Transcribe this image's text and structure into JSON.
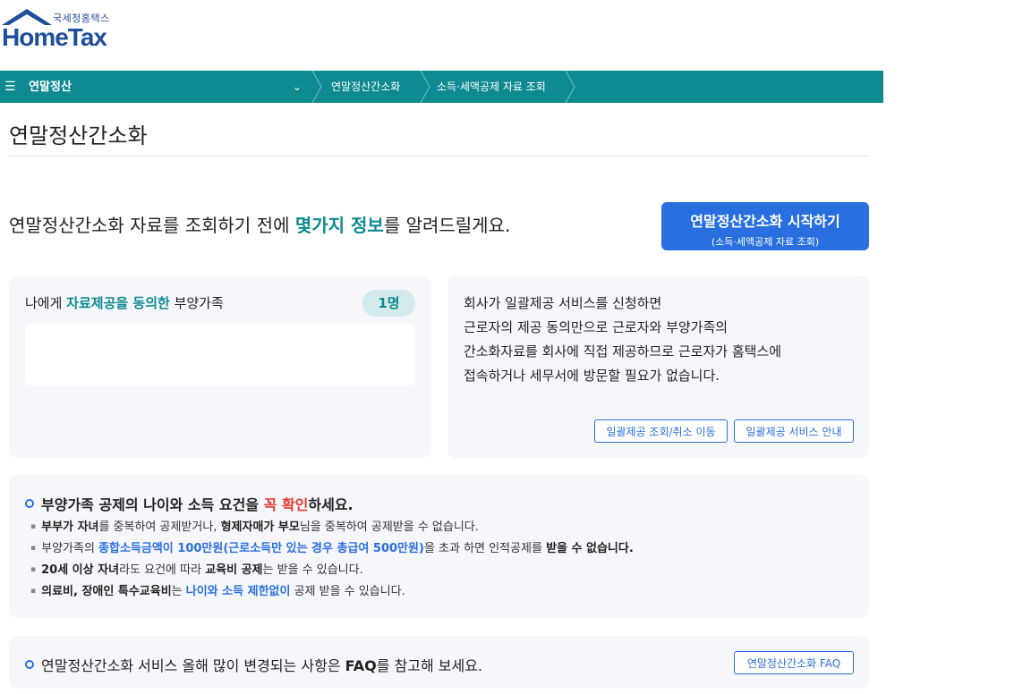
{
  "logo": {
    "korean": "국세청홈택스",
    "english": "HomeTax"
  },
  "nav": {
    "menu_label": "연말정산",
    "menu_icon": "hamburger-icon",
    "dropdown_icon": "chevron-down-icon",
    "breadcrumbs": [
      "연말정산간소화",
      "소득·세액공제 자료 조회"
    ]
  },
  "page": {
    "title": "연말정산간소화"
  },
  "intro": {
    "text_before": "연말정산간소화 자료를 조회하기 전에 ",
    "highlight": "몇가지 정보",
    "text_after": "를 알려드릴게요."
  },
  "start_button": {
    "line1": "연말정산간소화 시작하기",
    "line2": "(소득·세액공제 자료 조회)"
  },
  "consent_card": {
    "label_before": "나에게 ",
    "label_highlight": "자료제공을 동의한",
    "label_after": " 부양가족",
    "count": "1명"
  },
  "company_card": {
    "lines": [
      "회사가 일괄제공 서비스를 신청하면",
      "근로자의 제공 동의만으로 근로자와 부양가족의",
      "간소화자료를 회사에 직접 제공하므로 근로자가 홈택스에",
      "접속하거나 세무서에 방문할 필요가 없습니다."
    ],
    "button_lookup": "일괄제공 조회/취소 이동",
    "button_guide": "일괄제공 서비스 안내"
  },
  "notice": {
    "head_before": "부양가족 공제의 나이와 소득 요건을 ",
    "head_red": "꼭 확인",
    "head_after": "하세요.",
    "items": [
      {
        "b1": "부부가 자녀",
        "t1": "를 중복하여 공제받거나, ",
        "b2": "형제자매가 부모",
        "t2": "님을 중복하여 공제받을 수 없습니다."
      },
      {
        "t0": "부양가족의 ",
        "blue": "종합소득금액이 100만원(근로소득만 있는 경우 총급여 500만원)",
        "t1": "을 초과 하면 인적공제를 ",
        "b1": "받을 수 없습니다."
      },
      {
        "b1": "20세 이상 자녀",
        "t1": "라도 요건에 따라 ",
        "b2": "교육비 공제",
        "t2": "는 받을 수 있습니다."
      },
      {
        "b1": "의료비, 장애인 특수교육비",
        "t1": "는 ",
        "blue": "나이와 소득 제한없이",
        "t2": " 공제 받을 수 있습니다."
      }
    ]
  },
  "faq": {
    "text_before": "연말정산간소화 서비스 올해 많이 변경되는 사항은 ",
    "bold": "FAQ",
    "text_after": "를 참고해 보세요.",
    "button": "연말정산간소화 FAQ"
  },
  "colors": {
    "teal": "#0e8a90",
    "blue": "#2a6fe0",
    "red": "#e23b2e",
    "card_bg": "#f5f7fb"
  }
}
